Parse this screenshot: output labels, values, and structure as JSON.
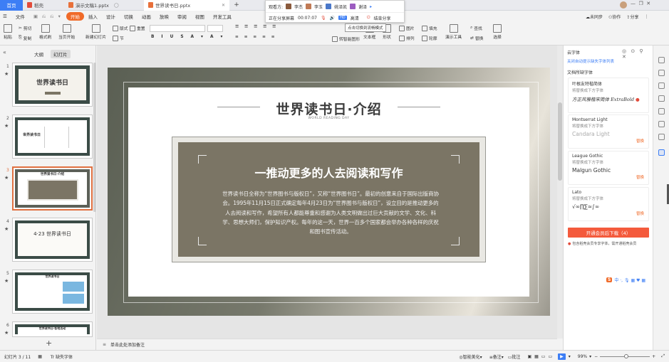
{
  "titlebar": {
    "home": "首页",
    "tabs": [
      {
        "label": "稻壳"
      },
      {
        "label": "演示文稿1.pptx"
      },
      {
        "label": "世界读书日.pptx"
      }
    ],
    "add": "+"
  },
  "share": {
    "viewer_label": "观看方:",
    "viewers": [
      "李杰",
      "李玉",
      "姚泽凯",
      "谢泽"
    ],
    "sharing_label": "正在分享屏幕",
    "timer": "00:07:07",
    "quality": "高清",
    "hd_badge": "HD",
    "end_label": "结束分享",
    "tooltip": "点击切换到流畅模式"
  },
  "menubar": {
    "file": "文件",
    "items": [
      "开始",
      "插入",
      "设计",
      "切换",
      "动画",
      "放映",
      "审阅",
      "视图",
      "开发工具"
    ],
    "active": "开始",
    "right": [
      "未同步",
      "协作",
      "分享"
    ]
  },
  "ribbon": {
    "paste": "粘贴",
    "cut": "剪切",
    "copy": "复制",
    "format_painter": "格式刷",
    "from_current": "当页开始",
    "new_slide": "新建幻灯片",
    "layout": "版式",
    "section": "节",
    "reset": "重置",
    "text_box": "文本框",
    "shape": "形状",
    "arrange": "排列",
    "outline": "轮廓",
    "image": "图片",
    "fill": "填充",
    "find": "查找",
    "replace": "替换",
    "select": "选择",
    "tools": "演示工具",
    "smartart": "转智能图形"
  },
  "leftpanel": {
    "tabs": [
      "大纲",
      "幻灯片"
    ],
    "active_tab": "幻灯片",
    "slides": [
      {
        "num": "1",
        "title": "世界读书日"
      },
      {
        "num": "2",
        "title": "世界读书日"
      },
      {
        "num": "3",
        "title": "世界读书日·介绍"
      },
      {
        "num": "4",
        "title": "4·23 世界读书日"
      },
      {
        "num": "5",
        "title": "世界读书日"
      },
      {
        "num": "6",
        "title": "世界读书日·各地活动"
      }
    ],
    "add": "+"
  },
  "slide": {
    "title": "世界读书日·介绍",
    "subtitle": "WORLD READING DAY",
    "box_heading": "一推动更多的人去阅读和写作",
    "box_body": "世界读书日全称为“世界图书与版权日”，又称“世界图书日”。最初的创意来自于国际出版商协会。1995年11月15日正式确定每年4月23日为“世界图书与版权日”，设立目的是推动更多的人去阅读和写作，希望所有人都能尊重和感谢为人类文明做出过巨大贡献的文学、文化、科学、思想大师们，保护知识产权。每年的这一天，世界一百多个国家都会举办各种各样的庆祝和图书宣传活动。"
  },
  "rpanel": {
    "title": "云字体",
    "link": "关闭自动提示缺失字体列表",
    "section": "文档所缺字体",
    "fonts": [
      {
        "name": "叶根友特楷简体",
        "desc": "将替换成下方字体",
        "preview": "方正风雅楷宋简体 ExtraBold",
        "action": ""
      },
      {
        "name": "Montserrat Light",
        "desc": "将替换成下方字体",
        "preview": "Candara Light",
        "action": "替换"
      },
      {
        "name": "League Gothic",
        "desc": "将替换成下方字体",
        "preview": "Malgun Gothic",
        "action": "替换"
      },
      {
        "name": "Lato",
        "desc": "将替换成下方字体",
        "preview": "√∞∏∑≈∫∞",
        "action": "替换"
      }
    ],
    "cta": "开通会员后下载（4）",
    "note": "包含稻壳会员专享字体，需开通稻壳会员"
  },
  "notes": {
    "placeholder": "单击此处添加备注"
  },
  "status": {
    "slide_count": "幻灯片 3 / 11",
    "missing_font": "缺失字体",
    "beautify": "智能美化",
    "notes": "备注",
    "comment": "批注",
    "zoom": "99%"
  },
  "colors": {
    "accent": "#f06a28",
    "home_tab": "#3d7ef5",
    "cta": "#f45a3c",
    "link": "#3d7ef5"
  }
}
